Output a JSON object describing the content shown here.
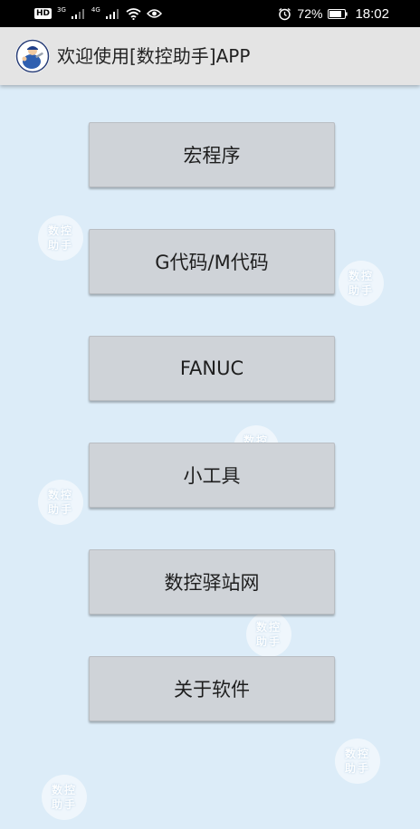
{
  "status_bar": {
    "hd_label": "HD",
    "sim1_network": "3G",
    "sim2_network": "4G",
    "battery_percent": "72%",
    "time": "18:02",
    "icons": [
      "signal-icon",
      "wifi-icon",
      "eye-icon",
      "alarm-icon",
      "battery-icon"
    ]
  },
  "app_bar": {
    "title": "欢迎使用[数控助手]APP",
    "logo_icon": "mechanic-logo-icon"
  },
  "menu": {
    "items": [
      {
        "label": "宏程序"
      },
      {
        "label": "G代码/M代码"
      },
      {
        "label": "FANUC"
      },
      {
        "label": "小工具"
      },
      {
        "label": "数控驿站网"
      },
      {
        "label": "关于软件"
      }
    ]
  },
  "watermark": {
    "text": "数控助手"
  },
  "colors": {
    "background": "#dcecf8",
    "button": "#cfd3d8",
    "app_bar": "#e4e4e4",
    "status_bar": "#000000"
  }
}
